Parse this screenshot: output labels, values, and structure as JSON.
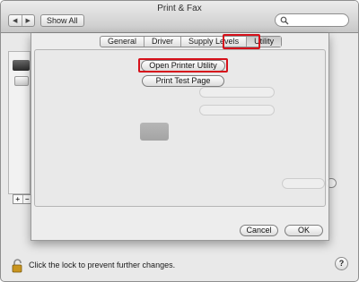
{
  "window": {
    "title": "Print & Fax",
    "back_glyph": "◀",
    "forward_glyph": "▶",
    "show_all_label": "Show All",
    "search_placeholder": ""
  },
  "sheet": {
    "tabs": [
      {
        "label": "General",
        "active": false
      },
      {
        "label": "Driver",
        "active": false
      },
      {
        "label": "Supply Levels",
        "active": false
      },
      {
        "label": "Utility",
        "active": true
      }
    ],
    "open_printer_utility_label": "Open Printer Utility",
    "print_test_page_label": "Print Test Page",
    "cancel_label": "Cancel",
    "ok_label": "OK",
    "highlight_color": "#d6111b"
  },
  "background": {
    "add_label": "+",
    "remove_label": "−"
  },
  "bottom": {
    "lock_text": "Click the lock to prevent further changes.",
    "help_label": "?"
  }
}
